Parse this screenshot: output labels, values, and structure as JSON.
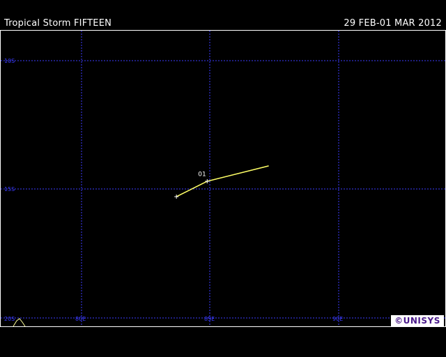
{
  "header": {
    "title": "Tropical Storm FIFTEEN",
    "date_range": "29 FEB-01 MAR 2012"
  },
  "map": {
    "lat_labels": [
      "10S",
      "15S",
      "20S"
    ],
    "lon_labels": [
      "80E",
      "85E",
      "90E"
    ],
    "grid_color": "#3b3bff",
    "track_color": "#ffff66",
    "track_points": [
      {
        "lat": -15.3,
        "lon": 83.7
      },
      {
        "lat": -14.7,
        "lon": 84.9
      },
      {
        "lat": -14.1,
        "lon": 87.3
      }
    ],
    "position_label": "01",
    "position_label_lat": -14.6,
    "position_label_lon": 84.6
  },
  "logo": {
    "text": "©UNISYS",
    "color": "#4a1a8a"
  }
}
